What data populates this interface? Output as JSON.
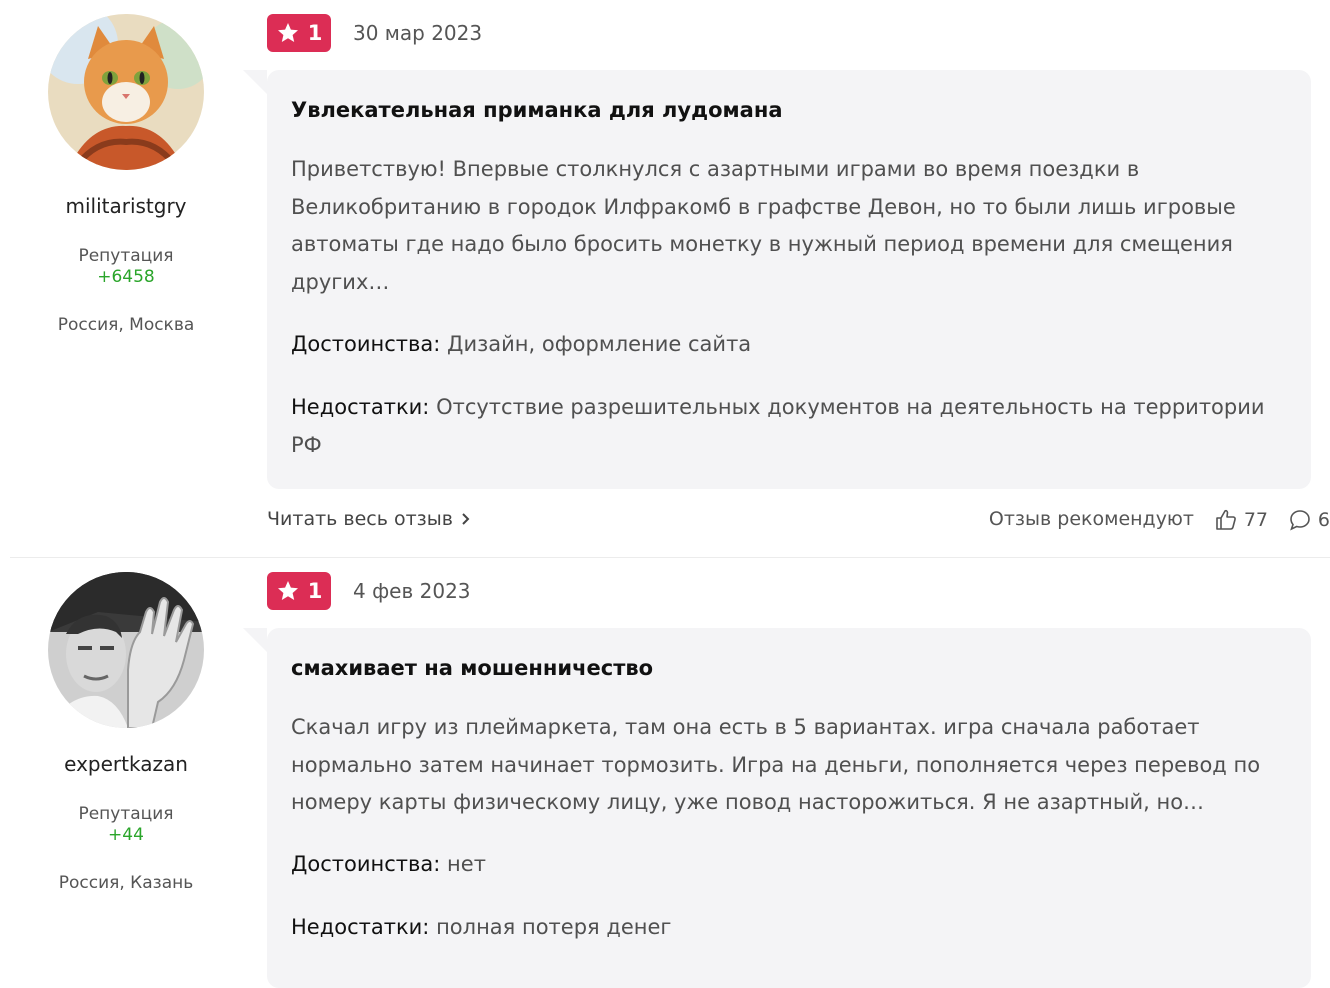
{
  "reviews": [
    {
      "author": {
        "username": "militaristgry",
        "reputation_label": "Репутация",
        "reputation_value": "+6458",
        "location": "Россия, Москва",
        "avatar": "cat-avatar"
      },
      "rating": "1",
      "date": "30 мар 2023",
      "title": "Увлекательная приманка для лудомана",
      "text": "Приветствую! Впервые столкнулся с азартными играми во время поездки в Великобританию в городок Илфракомб в графстве Девон, но то были лишь игровые автоматы где надо было бросить монетку в нужный период времени для смещения других…",
      "pros_label": "Достоинства:",
      "pros": "Дизайн, оформление сайта",
      "cons_label": "Недостатки:",
      "cons": "Отсутствие разрешительных документов на деятельность на территории РФ",
      "read_more": "Читать весь отзыв",
      "recommend_label": "Отзыв рекомендуют",
      "likes": "77",
      "comments": "6"
    },
    {
      "author": {
        "username": "expertkazan",
        "reputation_label": "Репутация",
        "reputation_value": "+44",
        "location": "Россия, Казань",
        "avatar": "photo-avatar"
      },
      "rating": "1",
      "date": "4 фев 2023",
      "title": "смахивает на мошенничество",
      "text": "Скачал игру из плеймаркета, там она есть в 5 вариантах. игра сначала работает нормально затем начинает тормозить. Игра на деньги, пополняется через перевод по номеру карты физическому лицу, уже повод насторожиться. Я не азартный, но…",
      "pros_label": "Достоинства:",
      "pros": "нет",
      "cons_label": "Недостатки:",
      "cons": "полная потеря денег"
    }
  ],
  "colors": {
    "badge": "#dc2d55",
    "reputation": "#2aa52a",
    "bubble": "#f4f4f6"
  }
}
